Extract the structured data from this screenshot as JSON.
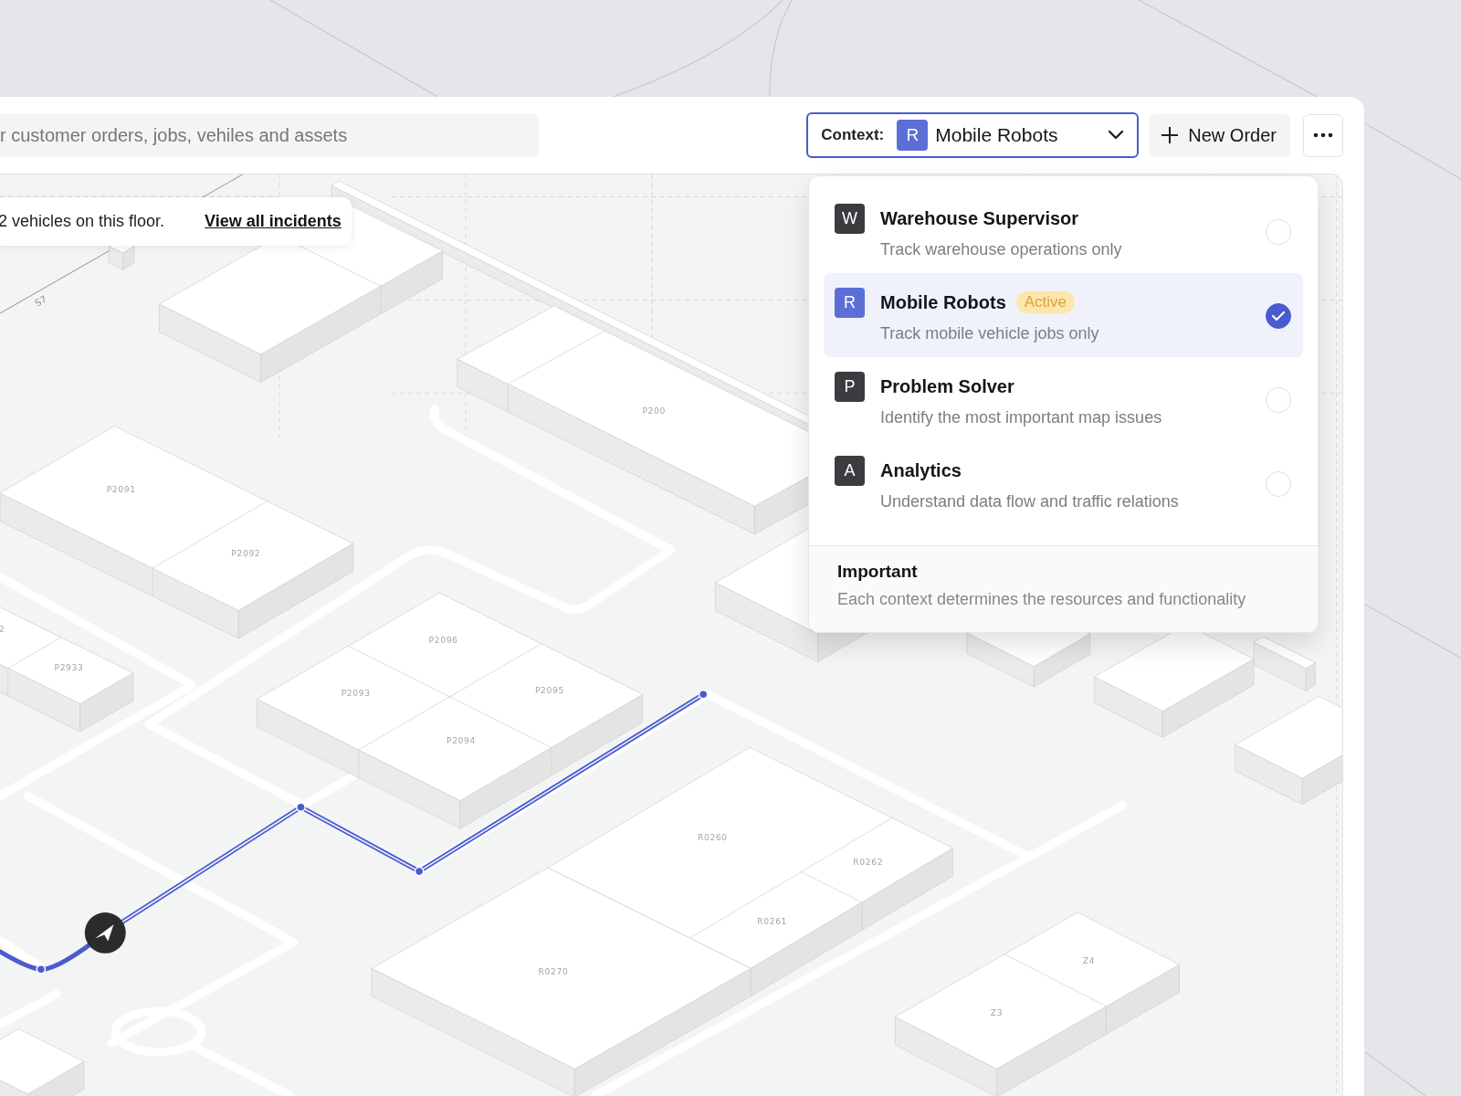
{
  "search": {
    "placeholder": "r customer orders, jobs, vehiles and assets"
  },
  "context": {
    "label": "Context:",
    "badge": "R",
    "color": "#5b6fd6",
    "value": "Mobile Robots",
    "expanded": true
  },
  "new_order": {
    "label": "New Order"
  },
  "incident_banner": {
    "text": "2 vehicles on this floor.",
    "link": "View all incidents"
  },
  "context_menu": {
    "items": [
      {
        "badge": "W",
        "color": "#3b3c3f",
        "title": "Warehouse Supervisor",
        "description": "Track warehouse operations only",
        "selected": false
      },
      {
        "badge": "R",
        "color": "#5b6fd6",
        "title": "Mobile Robots",
        "tag": "Active",
        "description": "Track mobile vehicle jobs only",
        "selected": true
      },
      {
        "badge": "P",
        "color": "#3b3c3f",
        "title": "Problem Solver",
        "description": "Identify the most important map issues",
        "selected": false
      },
      {
        "badge": "A",
        "color": "#3b3c3f",
        "title": "Analytics",
        "description": "Understand data flow and traffic relations",
        "selected": false
      }
    ],
    "note": {
      "title": "Important",
      "text": "Each context determines the resources and functionality"
    }
  },
  "map": {
    "zone_label": "S7",
    "blocks": [
      {
        "cells": [
          "P200"
        ]
      },
      {
        "cells": [
          "P2091",
          "P2092"
        ]
      },
      {
        "cells": [
          "2",
          "P2933"
        ]
      },
      {
        "cells": [
          "P2096",
          "P2093",
          "P2095",
          "P2094"
        ]
      },
      {
        "cells": [
          "R0260",
          "R0262",
          "R0261"
        ]
      },
      {
        "cells": [
          "R0270"
        ]
      },
      {
        "cells": [
          "Z3",
          "Z4"
        ]
      }
    ]
  }
}
